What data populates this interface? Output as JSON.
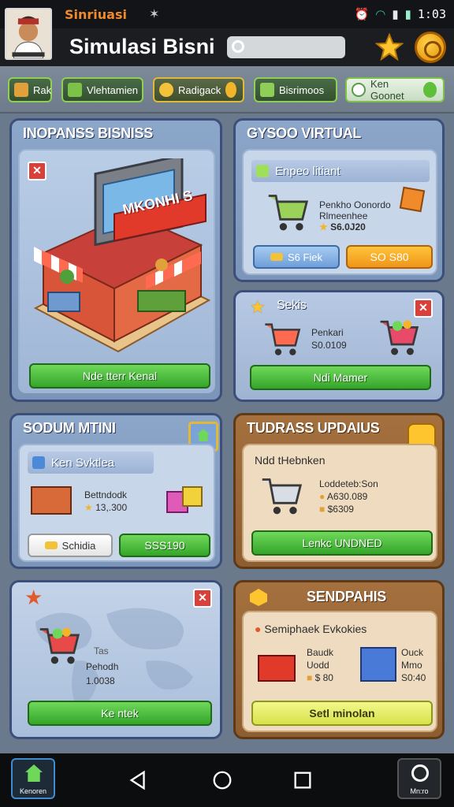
{
  "status_bar": {
    "app_name": "Sinriuasi",
    "time": "1:03"
  },
  "header": {
    "title": "Simulasi Bisni",
    "search_placeholder": ""
  },
  "toolbar": {
    "tabs": [
      {
        "label": "Rak"
      },
      {
        "label": "Vlehtamien"
      },
      {
        "label": "Radigack"
      },
      {
        "label": "Bisrimoos"
      },
      {
        "label": "Ken Goonet"
      }
    ]
  },
  "panels": {
    "business": {
      "title": "INOPANSS BISNISS",
      "sign": "MKONHI S",
      "button": "Nde tterr Kenal"
    },
    "virtual": {
      "title": "GYSOO VIRTUAL",
      "bar_label": "Enpeo litiant",
      "desc_line1": "Penkho Oonordo",
      "desc_line2": "Rlmeenhee",
      "price": "S6.0J20",
      "btn_blue": "S6 Fiek",
      "btn_orange": "SO S80"
    },
    "sekis": {
      "title": "Sekis",
      "desc_line1": "Penkari",
      "desc_line2": "S0.0109",
      "button": "Ndi Mamer"
    },
    "sodum": {
      "title": "SODUM MTINI",
      "bar_label": "Ken Svktlea",
      "desc_line1": "Bettndodk",
      "price": "13,.300",
      "btn_white": "Schidia",
      "btn_green": "SSS190"
    },
    "updates": {
      "title": "TUDRASS UPDAIUS",
      "subtitle": "Ndd tHebnken",
      "line1": "Loddeteb:Son",
      "line2": "A630.089",
      "line3": "$6309",
      "button": "Lenkc UNDNED"
    },
    "map": {
      "text1": "Tas",
      "text2": "Pehodh",
      "text3": "1.0038",
      "button": "Ke ntek"
    },
    "sendpahis": {
      "title": "SENDPAHIS",
      "subtitle": "Semiphaek Evkokies",
      "item1_line1": "Baudk",
      "item1_line2": "Uodd",
      "item1_price": "$ 80",
      "item2_line1": "Ouck",
      "item2_line2": "Mmo",
      "item2_price": "S0:40",
      "button": "Setl minolan"
    }
  },
  "navbar": {
    "left_label": "Kenoren",
    "right_label": "Mn:ro"
  },
  "colors": {
    "primary_green": "#34a52a",
    "panel_blue": "#7b95b8",
    "panel_brown": "#8e5d30",
    "accent_orange": "#f0951a",
    "close_red": "#d9403a"
  }
}
